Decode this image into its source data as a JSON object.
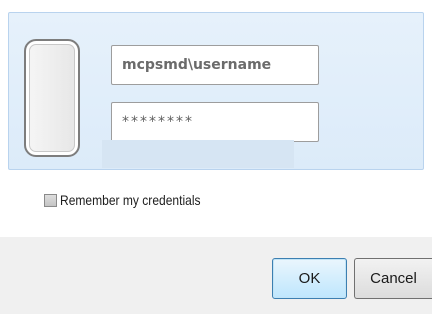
{
  "credentials": {
    "username": "mcpsmd\\username",
    "password_masked": "********"
  },
  "remember": {
    "label": "Remember my credentials",
    "checked": false
  },
  "buttons": {
    "ok": "OK",
    "cancel": "Cancel"
  },
  "colors": {
    "panel_background": "#e2eefa",
    "panel_border": "#b9d3ee",
    "ok_border": "#3c7fb1",
    "footer_background": "#f0f0f0"
  }
}
